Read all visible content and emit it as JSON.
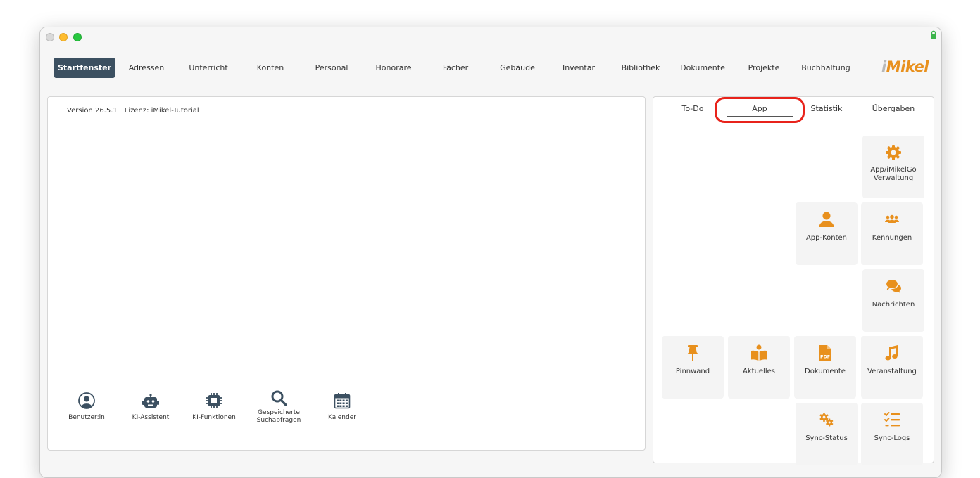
{
  "nav": {
    "items": [
      {
        "label": "Startfenster",
        "active": true
      },
      {
        "label": "Adressen"
      },
      {
        "label": "Unterricht"
      },
      {
        "label": "Konten"
      },
      {
        "label": "Personal"
      },
      {
        "label": "Honorare"
      },
      {
        "label": "Fächer"
      },
      {
        "label": "Gebäude"
      },
      {
        "label": "Inventar"
      },
      {
        "label": "Bibliothek"
      },
      {
        "label": "Dokumente"
      },
      {
        "label": "Projekte"
      },
      {
        "label": "Buchhaltung"
      }
    ],
    "logo_prefix": "i",
    "logo_rest": "Mikel"
  },
  "info": {
    "version": "Version 26.5.1",
    "license": "Lizenz: iMikel-Tutorial"
  },
  "tools": [
    {
      "label": "Benutzer:in",
      "icon": "user-circle-icon"
    },
    {
      "label": "KI-Assistent",
      "icon": "robot-icon"
    },
    {
      "label": "KI-Funktionen",
      "icon": "chip-icon"
    },
    {
      "label": "Gespeicherte Suchabfragen",
      "icon": "search-icon"
    },
    {
      "label": "Kalender",
      "icon": "calendar-icon"
    }
  ],
  "tabs": [
    {
      "label": "To-Do"
    },
    {
      "label": "App",
      "active": true
    },
    {
      "label": "Statistik"
    },
    {
      "label": "Übergaben"
    }
  ],
  "tiles": [
    {
      "label": "App/iMikelGo Verwaltung",
      "icon": "gear-icon"
    },
    {
      "label": "App-Konten",
      "icon": "user-icon"
    },
    {
      "label": "Kennungen",
      "icon": "users-icon"
    },
    {
      "label": "Nachrichten",
      "icon": "chat-icon"
    },
    {
      "label": "Pinnwand",
      "icon": "pin-icon"
    },
    {
      "label": "Aktuelles",
      "icon": "book-reader-icon"
    },
    {
      "label": "Dokumente",
      "icon": "pdf-file-icon"
    },
    {
      "label": "Veranstaltung",
      "icon": "music-note-icon"
    },
    {
      "label": "Sync-Status",
      "icon": "cogs-icon"
    },
    {
      "label": "Sync-Logs",
      "icon": "checklist-icon"
    }
  ],
  "colors": {
    "accent": "#e8901d",
    "nav_active_bg": "#3c5061",
    "highlight": "#e8231b",
    "tool_icon": "#3c5061"
  }
}
